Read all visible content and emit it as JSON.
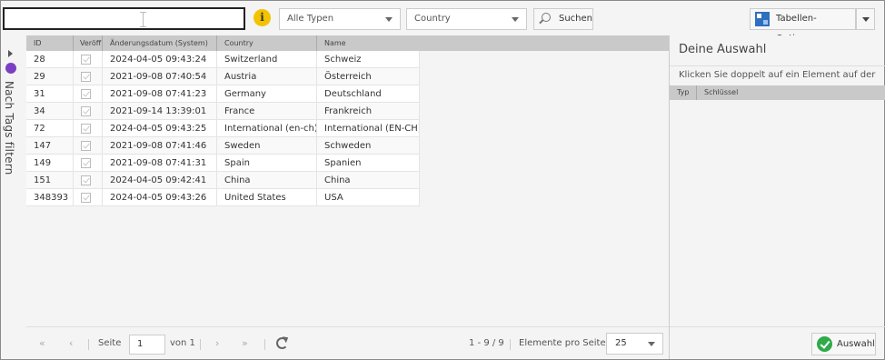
{
  "toolbar": {
    "search_value": "",
    "type_filter": "Alle Typen",
    "country_filter": "Country",
    "search_button": "Suchen",
    "table_options": "Tabellen-Optionen"
  },
  "sidebar": {
    "tag_filter_label": "Nach Tags filtern"
  },
  "grid": {
    "columns": [
      "ID",
      "Veröff",
      "Änderungsdatum (System)",
      "Country",
      "Name"
    ],
    "rows": [
      {
        "id": "28",
        "date": "2024-04-05 09:43:24",
        "country": "Switzerland",
        "name": "Schweiz"
      },
      {
        "id": "29",
        "date": "2021-09-08 07:40:54",
        "country": "Austria",
        "name": "Österreich"
      },
      {
        "id": "31",
        "date": "2021-09-08 07:41:23",
        "country": "Germany",
        "name": "Deutschland"
      },
      {
        "id": "34",
        "date": "2021-09-14 13:39:01",
        "country": "France",
        "name": "Frankreich"
      },
      {
        "id": "72",
        "date": "2024-04-05 09:43:25",
        "country": "International (en-ch)",
        "name": "International (EN-CH)"
      },
      {
        "id": "147",
        "date": "2021-09-08 07:41:46",
        "country": "Sweden",
        "name": "Schweden"
      },
      {
        "id": "149",
        "date": "2021-09-08 07:41:31",
        "country": "Spain",
        "name": "Spanien"
      },
      {
        "id": "151",
        "date": "2024-04-05 09:42:41",
        "country": "China",
        "name": "China"
      },
      {
        "id": "348393",
        "date": "2024-04-05 09:43:26",
        "country": "United States",
        "name": "USA"
      }
    ]
  },
  "pager": {
    "first": "«",
    "prev": "‹",
    "page_label": "Seite",
    "page_value": "1",
    "of_label": "von 1",
    "next": "›",
    "last": "»",
    "range": "1 - 9 / 9",
    "per_page_label": "Elemente pro Seite",
    "per_page_value": "25"
  },
  "selection_panel": {
    "title": "Deine Auswahl",
    "hint": "Klicken Sie doppelt auf ein Element auf der",
    "col_type": "Typ",
    "col_key": "Schlüssel",
    "select_button": "Auswahl"
  },
  "colors": {
    "info": "#f3c300",
    "tag": "#7b3fc4",
    "ok": "#2eaa4a",
    "header": "#c9c9c9"
  }
}
